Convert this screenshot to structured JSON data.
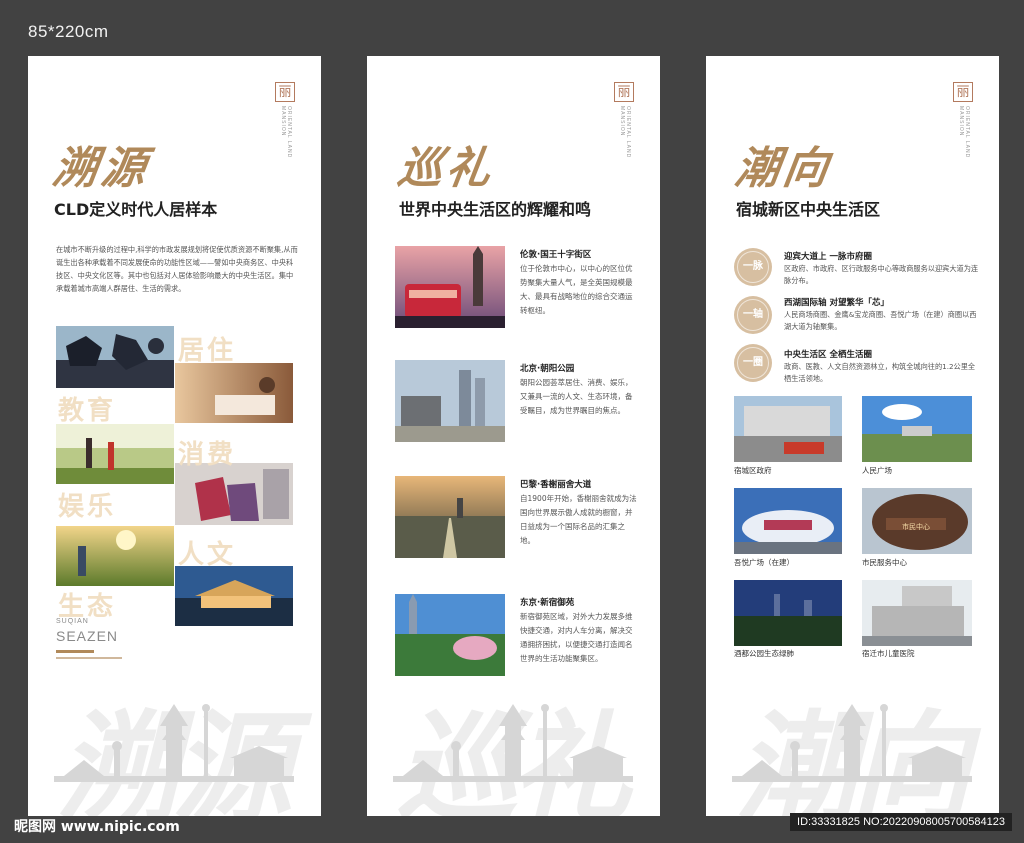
{
  "size_label": "85*220cm",
  "brand_logo": {
    "seal": "丽",
    "text": "ORIENTAL LAND MANSION"
  },
  "panel1": {
    "callig": "溯源",
    "subtitle": "CLD定义时代人居样本",
    "intro": "在城市不断升级的过程中,科学的市政发展规划将促使优质资源不断聚集,从而诞生出各种承载着不同发展使命的功能性区域——譬如中央商务区、中央科技区、中央文化区等。其中也包括对人居体验影响最大的中央生活区。集中承载着城市高端人群居住、生活的需求。",
    "words": [
      "居住",
      "教育",
      "消费",
      "娱乐",
      "人文",
      "生态"
    ],
    "suqian": "SUQIAN",
    "seazen": "SEAZEN"
  },
  "panel2": {
    "callig": "巡礼",
    "subtitle": "世界中央生活区的辉耀和鸣",
    "items": [
      {
        "title": "伦敦·国王十字街区",
        "desc": "位于伦敦市中心，以中心的区位优势聚集大量人气，是全英国规模最大、最具有战略地位的综合交通运转枢纽。"
      },
      {
        "title": "北京·朝阳公园",
        "desc": "朝阳公园荟萃居住、消费、娱乐，又兼具一流的人文、生态环境，备受瞩目，成为世界瞩目的焦点。"
      },
      {
        "title": "巴黎·香榭丽舍大道",
        "desc": "自1900年开始，香榭丽舍就成为法国向世界展示傲人成就的橱窗，并日益成为一个国际名品的汇集之地。"
      },
      {
        "title": "东京·新宿御苑",
        "desc": "新宿御苑区域，对外大力发展多维快捷交通，对内人车分离，解决交通拥挤困扰，以便捷交通打造闻名世界的生活功能聚集区。"
      }
    ]
  },
  "panel3": {
    "callig": "潮向",
    "subtitle": "宿城新区中央生活区",
    "rows": [
      {
        "badge": "一脉",
        "title": "迎宾大道上 一脉市府圈",
        "desc": "区政府、市政府、区行政服务中心等政商服务以迎宾大道为连脉分布。"
      },
      {
        "badge": "一轴",
        "title": "西湖国际轴 对望繁华「芯」",
        "desc": "人民商场商圈、金鹰&宝龙商圈、吾悦广场（在建）商圈以西湖大道为轴聚集。"
      },
      {
        "badge": "一圈",
        "title": "中央生活区 全栖生活圈",
        "desc": "政商、医教、人文自然资源林立，构筑全城向往的1.2公里全栖生活领地。"
      }
    ],
    "captions": [
      "宿城区政府",
      "人民广场",
      "吾悦广场（在建）",
      "市民服务中心",
      "酒都公园生态绿肺",
      "宿迁市儿童医院"
    ],
    "sign_text": "市民中心"
  },
  "footer": {
    "watermark": "昵图网 www.nipic.com",
    "id_line": "ID:33331825 NO:20220908005700584123"
  }
}
